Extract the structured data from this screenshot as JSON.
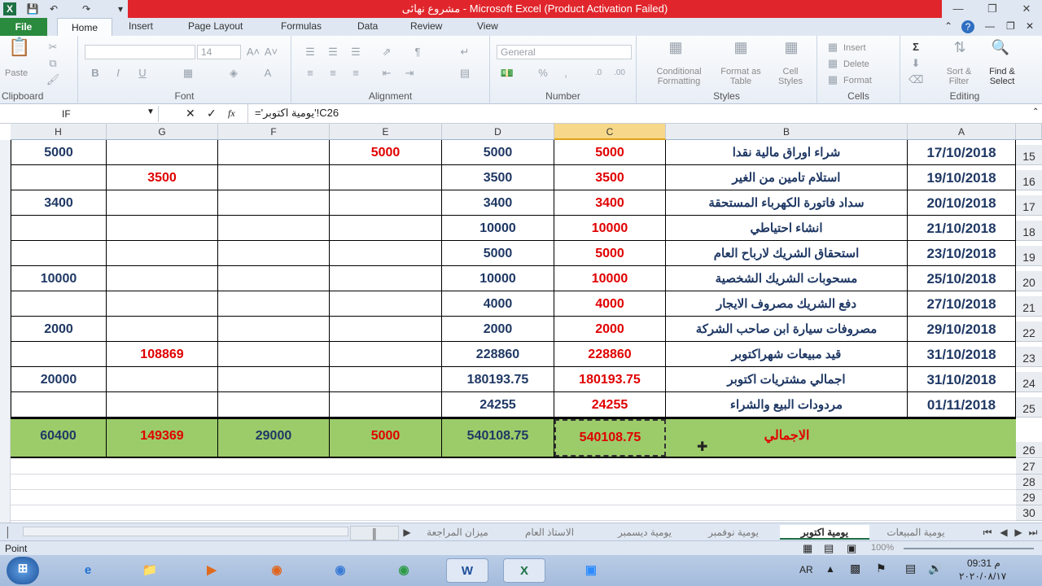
{
  "window": {
    "title": "مشروع نهائى  -  Microsoft Excel (Product Activation Failed)"
  },
  "ribbon_tabs": [
    "File",
    "Home",
    "Insert",
    "Page Layout",
    "Formulas",
    "Data",
    "Review",
    "View"
  ],
  "ribbon": {
    "clipboard": {
      "label": "Clipboard",
      "paste": "Paste"
    },
    "font": {
      "label": "Font",
      "size": "14"
    },
    "alignment": {
      "label": "Alignment"
    },
    "number": {
      "label": "Number",
      "format": "General"
    },
    "styles": {
      "label": "Styles",
      "cond": "Conditional Formatting",
      "table": "Format as Table",
      "cell": "Cell Styles"
    },
    "cells": {
      "label": "Cells",
      "insert": "Insert",
      "delete": "Delete",
      "format": "Format"
    },
    "editing": {
      "label": "Editing",
      "sort": "Sort & Filter",
      "find": "Find & Select"
    }
  },
  "formula_bar": {
    "name_box": "IF",
    "fx": "fx",
    "formula": "='يومية اكتوبر'!C26"
  },
  "columns": [
    "H",
    "G",
    "F",
    "E",
    "D",
    "C",
    "B",
    "A"
  ],
  "rows": [
    {
      "num": "15",
      "A": "17/10/2018",
      "B": "شراء اوراق مالية نقدا",
      "C": "5000",
      "D": "5000",
      "E": "5000",
      "F": "",
      "G": "",
      "H": "5000"
    },
    {
      "num": "16",
      "A": "19/10/2018",
      "B": "استلام تامين من الغير",
      "C": "3500",
      "D": "3500",
      "E": "",
      "F": "",
      "G": "3500",
      "H": ""
    },
    {
      "num": "17",
      "A": "20/10/2018",
      "B": "سداد فاتورة الكهرباء المستحقة",
      "C": "3400",
      "D": "3400",
      "E": "",
      "F": "",
      "G": "",
      "H": "3400"
    },
    {
      "num": "18",
      "A": "21/10/2018",
      "B": "انشاء احتياطي",
      "C": "10000",
      "D": "10000",
      "E": "",
      "F": "",
      "G": "",
      "H": ""
    },
    {
      "num": "19",
      "A": "23/10/2018",
      "B": "استحقاق الشريك لارباح العام",
      "C": "5000",
      "D": "5000",
      "E": "",
      "F": "",
      "G": "",
      "H": ""
    },
    {
      "num": "20",
      "A": "25/10/2018",
      "B": "مسحوبات الشريك الشخصية",
      "C": "10000",
      "D": "10000",
      "E": "",
      "F": "",
      "G": "",
      "H": "10000"
    },
    {
      "num": "21",
      "A": "27/10/2018",
      "B": "دفع الشريك مصروف الايجار",
      "C": "4000",
      "D": "4000",
      "E": "",
      "F": "",
      "G": "",
      "H": ""
    },
    {
      "num": "22",
      "A": "29/10/2018",
      "B": "مصروفات سيارة ابن صاحب الشركة",
      "C": "2000",
      "D": "2000",
      "E": "",
      "F": "",
      "G": "",
      "H": "2000"
    },
    {
      "num": "23",
      "A": "31/10/2018",
      "B": "قيد مبيعات شهراكتوبر",
      "C": "228860",
      "D": "228860",
      "E": "",
      "F": "",
      "G": "108869",
      "H": ""
    },
    {
      "num": "24",
      "A": "31/10/2018",
      "B": "اجمالي  مشتريات اكتوبر",
      "C": "180193.75",
      "D": "180193.75",
      "E": "",
      "F": "",
      "G": "",
      "H": "20000"
    },
    {
      "num": "25",
      "A": "01/11/2018",
      "B": "مردودات البيع والشراء",
      "C": "24255",
      "D": "24255",
      "E": "",
      "F": "",
      "G": "",
      "H": ""
    }
  ],
  "total_row": {
    "num": "26",
    "B": "الاجمالي",
    "C": "540108.75",
    "D": "540108.75",
    "E": "5000",
    "F": "29000",
    "G": "149369",
    "H": "60400"
  },
  "empty_rows": [
    "27",
    "28",
    "29",
    "30"
  ],
  "sheet_tabs": [
    "يومية المبيعات",
    "يومية اكتوبر",
    "يومية نوفمبر",
    "يومية ديسمبر",
    "الاستاذ العام",
    "ميزان المراجعة"
  ],
  "status": {
    "mode": "Point",
    "zoom": "100%"
  },
  "taskbar": {
    "lang": "AR",
    "time": "09:31 م",
    "date": "٢٠٢٠/٠٨/١٧"
  }
}
